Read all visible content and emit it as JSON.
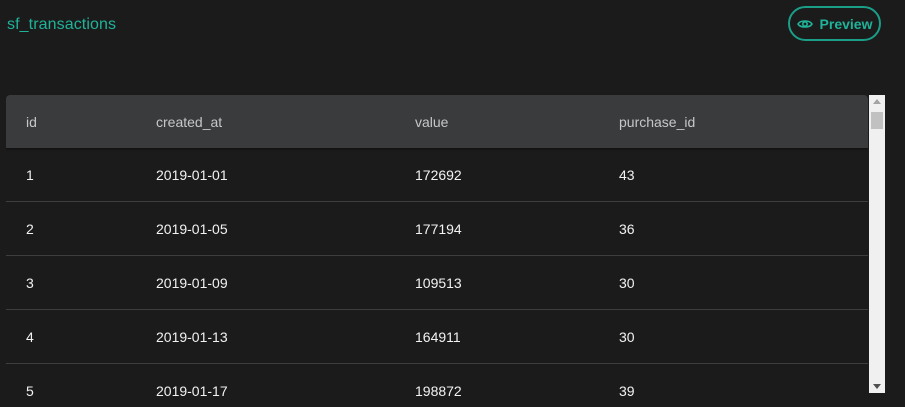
{
  "title": "sf_transactions",
  "preview_button": {
    "label": "Preview",
    "icon": "eye-icon"
  },
  "colors": {
    "accent": "#1fb39a",
    "background": "#1b1b1b",
    "header_bg": "#3a3b3c"
  },
  "table": {
    "columns": [
      "id",
      "created_at",
      "value",
      "purchase_id"
    ],
    "rows": [
      [
        "1",
        "2019-01-01",
        "172692",
        "43"
      ],
      [
        "2",
        "2019-01-05",
        "177194",
        "36"
      ],
      [
        "3",
        "2019-01-09",
        "109513",
        "30"
      ],
      [
        "4",
        "2019-01-13",
        "164911",
        "30"
      ],
      [
        "5",
        "2019-01-17",
        "198872",
        "39"
      ]
    ]
  }
}
